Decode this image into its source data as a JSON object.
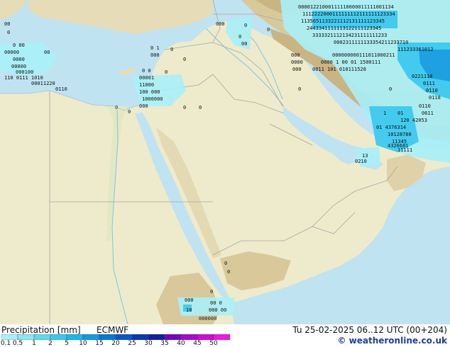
{
  "legend": {
    "title": "Precipitation [mm]",
    "model": "ECMWF",
    "valid": "Tu 25-02-2025 06..12 UTC (00+204)",
    "credit": "© weatheronline.co.uk",
    "ticks": [
      "0.1",
      "0.5",
      "1",
      "2",
      "5",
      "10",
      "15",
      "20",
      "25",
      "30",
      "35",
      "40",
      "45",
      "50"
    ],
    "colors": [
      "#a8f0f8",
      "#88e8f8",
      "#60d8f0",
      "#38c8f0",
      "#18b8e8",
      "#1098e0",
      "#0878d8",
      "#0858c8",
      "#0838b8",
      "#1020a0",
      "#7008c0",
      "#a808d0",
      "#d008d8",
      "#f018e0"
    ]
  },
  "map_colors": {
    "sea": "#bfe3f0",
    "land_low": "#eeeacc",
    "land_mid": "#e6ddb8",
    "land_high": "#d9c99a",
    "mountain": "#c9b483",
    "border": "#a6a6a6",
    "precip_light": "#a8f0f8",
    "precip_mid": "#38c8f0",
    "precip_heavy": "#1098e0"
  }
}
